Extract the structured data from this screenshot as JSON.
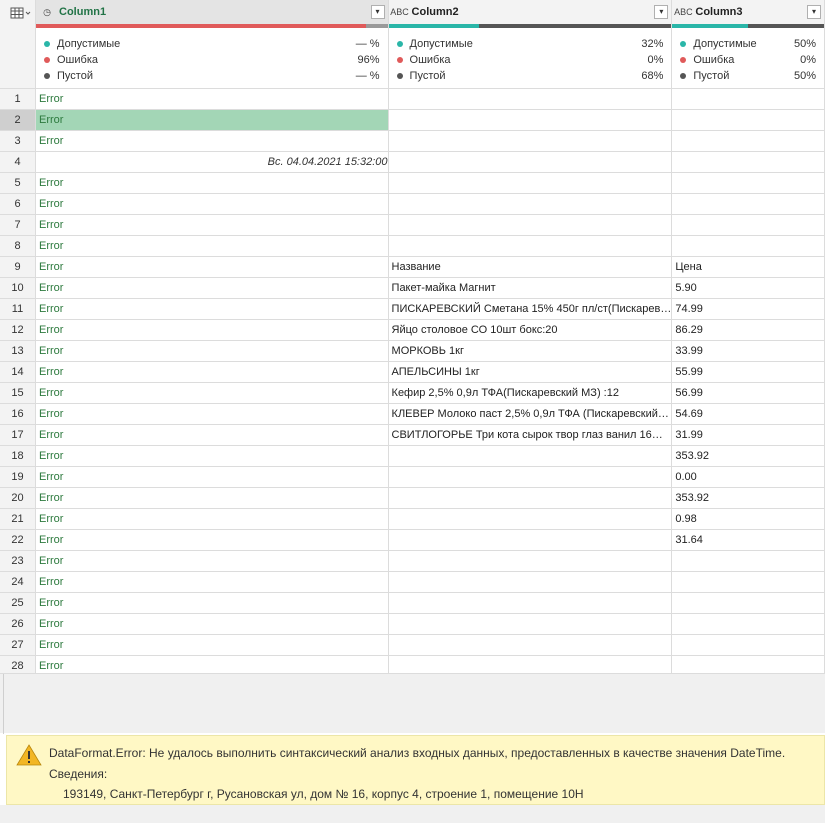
{
  "columns": [
    {
      "name": "Column1",
      "type_icon": "calendar-clock-icon",
      "type_glyph": "◷",
      "selected": true,
      "quality": {
        "valid": "— %",
        "error": "96%",
        "empty": "— %"
      },
      "bar": [
        {
          "color": "#e05a5a",
          "frac": 0.94
        },
        {
          "color": "#9a9a9a",
          "frac": 0.06
        }
      ]
    },
    {
      "name": "Column2",
      "type_icon": "text-type-icon",
      "type_glyph": "ABC",
      "selected": false,
      "quality": {
        "valid": "32%",
        "error": "0%",
        "empty": "68%"
      },
      "bar": [
        {
          "color": "#2ab6a8",
          "frac": 0.32
        },
        {
          "color": "#555555",
          "frac": 0.68
        }
      ]
    },
    {
      "name": "Column3",
      "type_icon": "text-type-icon",
      "type_glyph": "ABC",
      "selected": false,
      "quality": {
        "valid": "50%",
        "error": "0%",
        "empty": "50%"
      },
      "bar": [
        {
          "color": "#2ab6a8",
          "frac": 0.5
        },
        {
          "color": "#555555",
          "frac": 0.5
        }
      ]
    }
  ],
  "quality_labels": {
    "valid": "Допустимые",
    "error": "Ошибка",
    "empty": "Пустой"
  },
  "quality_colors": {
    "valid": "#2ab6a8",
    "error": "#e05a5a",
    "empty": "#555555"
  },
  "rows": [
    {
      "n": "1",
      "c1": "Error",
      "c2": "",
      "c3": ""
    },
    {
      "n": "2",
      "c1": "Error",
      "c2": "",
      "c3": "",
      "selected": true
    },
    {
      "n": "3",
      "c1": "Error",
      "c2": "",
      "c3": ""
    },
    {
      "n": "4",
      "c1": "Вс. 04.04.2021 15:32:00",
      "c1_kind": "datetime",
      "c2": "",
      "c3": ""
    },
    {
      "n": "5",
      "c1": "Error",
      "c2": "",
      "c3": ""
    },
    {
      "n": "6",
      "c1": "Error",
      "c2": "",
      "c3": ""
    },
    {
      "n": "7",
      "c1": "Error",
      "c2": "",
      "c3": ""
    },
    {
      "n": "8",
      "c1": "Error",
      "c2": "",
      "c3": ""
    },
    {
      "n": "9",
      "c1": "Error",
      "c2": "Название",
      "c3": "Цена"
    },
    {
      "n": "10",
      "c1": "Error",
      "c2": "Пакет-майка Магнит",
      "c3": "5.90"
    },
    {
      "n": "11",
      "c1": "Error",
      "c2": "ПИСКАРЕВСКИЙ Сметана 15% 450г пл/ст(Пискарев…",
      "c3": "74.99"
    },
    {
      "n": "12",
      "c1": "Error",
      "c2": "Яйцо столовое СО 10шт бокс:20",
      "c3": "86.29"
    },
    {
      "n": "13",
      "c1": "Error",
      "c2": "МОРКОВЬ 1кг",
      "c3": "33.99"
    },
    {
      "n": "14",
      "c1": "Error",
      "c2": "АПЕЛЬСИНЫ 1кг",
      "c3": "55.99"
    },
    {
      "n": "15",
      "c1": "Error",
      "c2": "Кефир 2,5% 0,9л ТФА(Пискаревский МЗ) :12",
      "c3": "56.99"
    },
    {
      "n": "16",
      "c1": "Error",
      "c2": "КЛЕВЕР Молоко паст 2,5% 0,9л ТФА (Пискаревский…",
      "c3": "54.69"
    },
    {
      "n": "17",
      "c1": "Error",
      "c2": "СВИТЛОГОРЬЕ Три кота сырок твор глаз ванил 16…",
      "c3": "31.99"
    },
    {
      "n": "18",
      "c1": "Error",
      "c2": "",
      "c3": "353.92"
    },
    {
      "n": "19",
      "c1": "Error",
      "c2": "",
      "c3": "0.00"
    },
    {
      "n": "20",
      "c1": "Error",
      "c2": "",
      "c3": "353.92"
    },
    {
      "n": "21",
      "c1": "Error",
      "c2": "",
      "c3": "0.98"
    },
    {
      "n": "22",
      "c1": "Error",
      "c2": "",
      "c3": "31.64"
    },
    {
      "n": "23",
      "c1": "Error",
      "c2": "",
      "c3": ""
    },
    {
      "n": "24",
      "c1": "Error",
      "c2": "",
      "c3": ""
    },
    {
      "n": "25",
      "c1": "Error",
      "c2": "",
      "c3": ""
    },
    {
      "n": "26",
      "c1": "Error",
      "c2": "",
      "c3": ""
    },
    {
      "n": "27",
      "c1": "Error",
      "c2": "",
      "c3": ""
    },
    {
      "n": "28",
      "c1": "Error",
      "c2": "",
      "c3": ""
    }
  ],
  "error_panel": {
    "icon": "warning-icon",
    "message": "DataFormat.Error: Не удалось выполнить синтаксический анализ входных данных, предоставленных в качестве значения DateTime.",
    "details_label": "Сведения:",
    "details_value": "193149, Санкт-Петербург г, Русановская ул, дом № 16, корпус 4, строение 1, помещение 10Н"
  }
}
